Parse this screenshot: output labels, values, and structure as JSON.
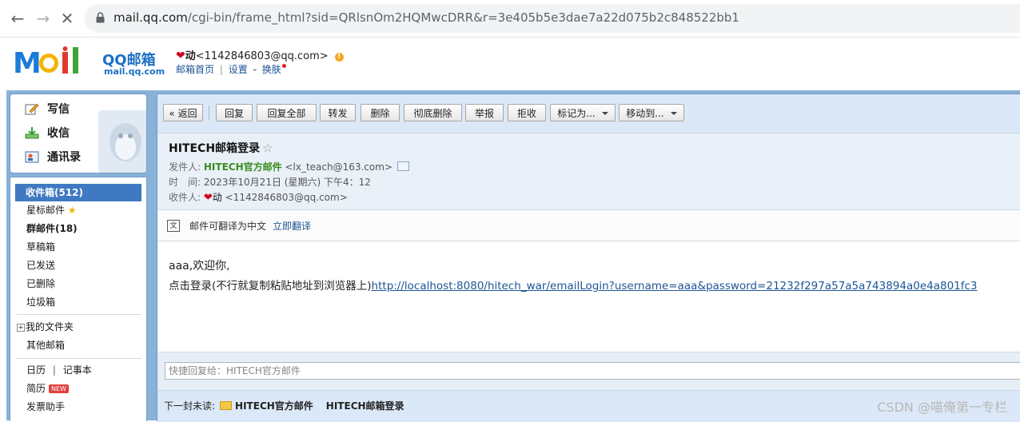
{
  "browser": {
    "url_host": "mail.qq.com",
    "url_path": "/cgi-bin/frame_html?sid=QRlsnOm2HQMwcDRR&r=3e405b5e3dae7a22d075b2c848522bb1"
  },
  "logo": {
    "brand": "MOil",
    "name": "QQ邮箱",
    "domain": "mail.qq.com"
  },
  "user": {
    "nickname": "动",
    "email": "<1142846803@qq.com>",
    "links": {
      "home": "邮箱首页",
      "divider": "|",
      "settings": "设置",
      "dash": "-",
      "skin": "换肤"
    }
  },
  "sidebar": {
    "top_items": {
      "compose": "写信",
      "receive": "收信",
      "contacts": "通讯录"
    },
    "folders": {
      "inbox": "收件箱(512)",
      "starred": "星标邮件",
      "group": "群邮件(18)",
      "drafts": "草稿箱",
      "sent": "已发送",
      "deleted": "已删除",
      "trash": "垃圾箱",
      "my_folders": "我的文件夹",
      "other_mail": "其他邮箱",
      "calendar": "日历",
      "notes": "记事本",
      "resume": "简历",
      "resume_badge": "NEW",
      "send_helper": "发票助手"
    }
  },
  "toolbar": {
    "back": "« 返回",
    "reply": "回复",
    "reply_all": "回复全部",
    "forward": "转发",
    "delete": "删除",
    "delete_forever": "彻底删除",
    "report": "举报",
    "reject": "拒收",
    "mark_as": "标记为...",
    "move_to": "移动到..."
  },
  "mail": {
    "subject": "HITECH邮箱登录",
    "from_label": "发件人:",
    "from_name": "HITECH官方邮件",
    "from_email": "<lx_teach@163.com>",
    "time_label": "时　间:",
    "time_value": "2023年10月21日 (星期六) 下午4：12",
    "to_label": "收件人:",
    "to_name": "动",
    "to_email": "<1142846803@qq.com>",
    "translate_text": "邮件可翻译为中文",
    "translate_link": "立即翻译",
    "body_greeting": "aaa,欢迎你,",
    "body_prefix": "点击登录(不行就复制粘贴地址到浏览器上)",
    "body_link": "http://localhost:8080/hitech_war/emailLogin?username=aaa&password=21232f297a57a5a743894a0e4a801fc3",
    "quick_reply_placeholder": "快捷回复给：HITECH官方邮件",
    "next_unread_label": "下一封未读:",
    "next_unread_sender": "HITECH官方邮件",
    "next_unread_subject": "HITECH邮箱登录"
  },
  "watermark": "CSDN @喵俺第一专栏"
}
